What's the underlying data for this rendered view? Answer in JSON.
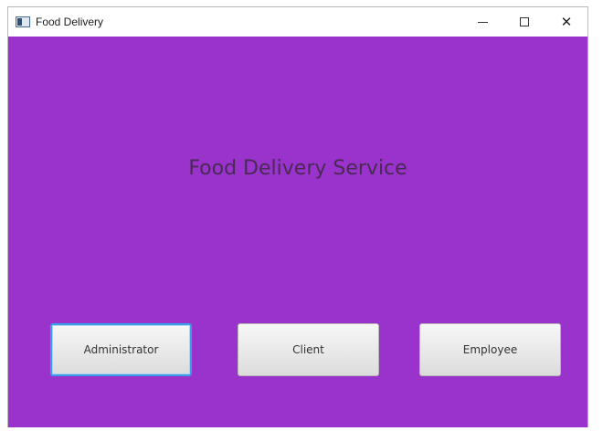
{
  "window": {
    "title": "Food Delivery",
    "controls": {
      "minimize": "—",
      "maximize": "☐",
      "close": "✕"
    }
  },
  "main": {
    "headline": "Food Delivery Service",
    "background_color": "#9933cc",
    "buttons": [
      {
        "label": "Administrator",
        "focused": true
      },
      {
        "label": "Client",
        "focused": false
      },
      {
        "label": "Employee",
        "focused": false
      }
    ]
  },
  "icons": [
    "app-icon",
    "minimize-icon",
    "maximize-icon",
    "close-icon"
  ]
}
